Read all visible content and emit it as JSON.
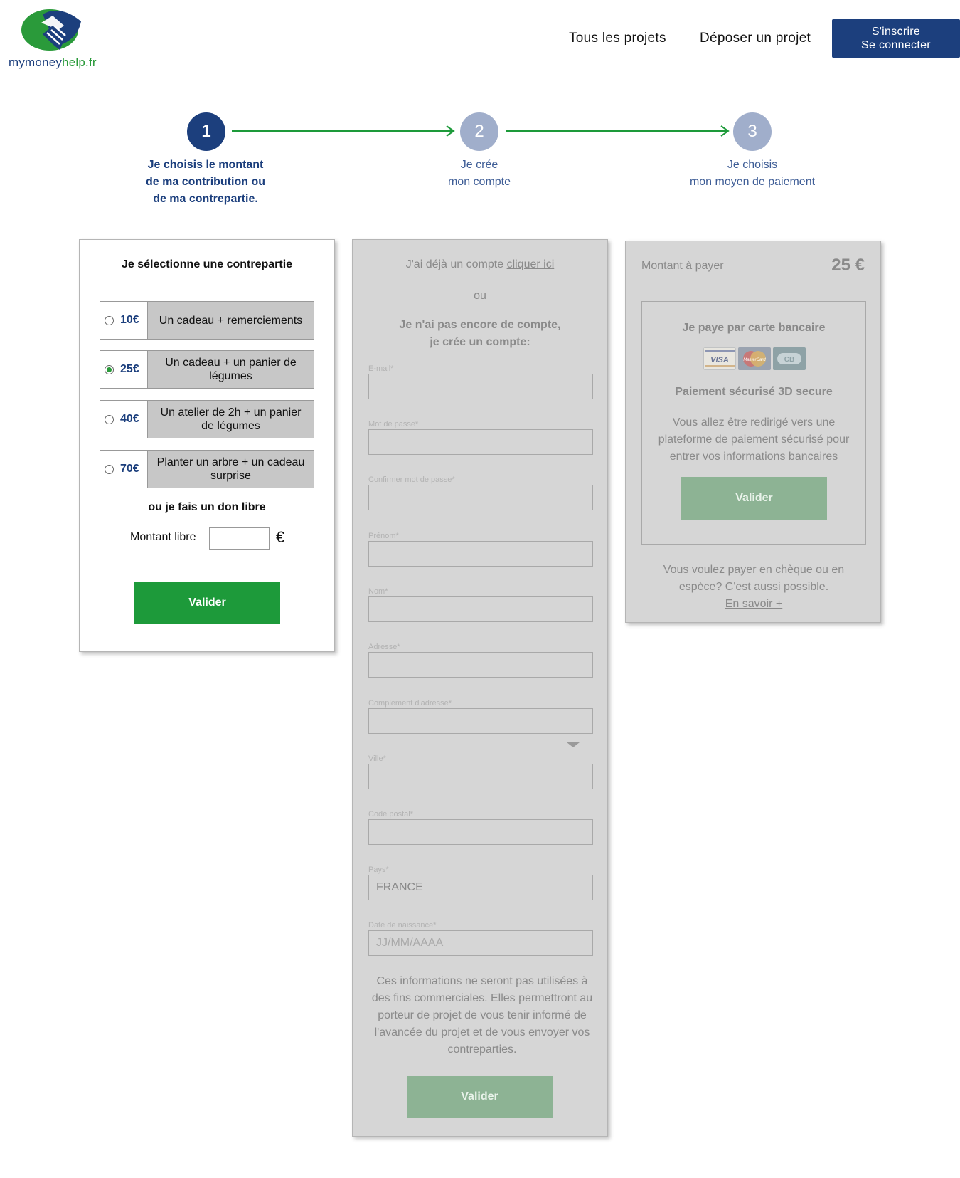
{
  "header": {
    "logo": {
      "part1": "mymoney",
      "part2": "help.fr",
      "colors": {
        "blue": "#1c3f7d",
        "green": "#2a9a3a"
      }
    },
    "nav": [
      "Tous les projets",
      "Déposer un projet"
    ],
    "auth": {
      "line1": "S'inscrire",
      "line2": "Se connecter"
    }
  },
  "stepper": {
    "steps": [
      {
        "number": "1",
        "lines": [
          "Je choisis le montant",
          "de ma contribution ou",
          "de ma contrepartie."
        ],
        "active": true
      },
      {
        "number": "2",
        "lines": [
          "Je crée",
          "mon compte"
        ],
        "active": false
      },
      {
        "number": "3",
        "lines": [
          "Je choisis",
          "mon moyen de paiement"
        ],
        "active": false
      }
    ],
    "arrow_color": "#1d9a3a"
  },
  "contrepartie": {
    "title": "Je sélectionne une contrepartie",
    "options": [
      {
        "price": "10€",
        "label": "Un cadeau + remerciements",
        "selected": false
      },
      {
        "price": "25€",
        "label": "Un cadeau + un panier de légumes",
        "selected": true
      },
      {
        "price": "40€",
        "label": "Un atelier de 2h + un panier de légumes",
        "selected": false
      },
      {
        "price": "70€",
        "label": "Planter un arbre + un cadeau surprise",
        "selected": false
      }
    ],
    "don_libre": "ou je fais un don libre",
    "montant_libre_label": "Montant libre",
    "montant_libre_value": "",
    "currency": "€",
    "submit": "Valider"
  },
  "account": {
    "already": "J'ai déjà un compte ",
    "already_link": "cliquer ici",
    "or": "ou",
    "create_line1": "Je n'ai pas encore de compte,",
    "create_line2": "je crée un compte:",
    "fields": [
      {
        "label": "E-mail*",
        "value": "",
        "placeholder": ""
      },
      {
        "label": "Mot de passe*",
        "value": "",
        "placeholder": ""
      },
      {
        "label": "Confirmer mot de passe*",
        "value": "",
        "placeholder": ""
      },
      {
        "label": "Prénom*",
        "value": "",
        "placeholder": ""
      },
      {
        "label": "Nom*",
        "value": "",
        "placeholder": ""
      },
      {
        "label": "Adresse*",
        "value": "",
        "placeholder": ""
      },
      {
        "label": "Complément d'adresse*",
        "value": "",
        "placeholder": ""
      },
      {
        "label": "Ville*",
        "value": "",
        "placeholder": ""
      },
      {
        "label": "Code postal*",
        "value": "",
        "placeholder": ""
      },
      {
        "label": "Pays*",
        "value": "FRANCE",
        "placeholder": ""
      },
      {
        "label": "Date de naissance*",
        "value": "",
        "placeholder": "JJ/MM/AAAA"
      }
    ],
    "note": "Ces informations ne seront pas utilisées à des fins commerciales. Elles permettront au porteur de projet de vous tenir informé de l'avancée du projet et de vous envoyer vos contreparties.",
    "submit": "Valider"
  },
  "payment": {
    "amount_label": "Montant à payer",
    "amount": "25 €",
    "card_title": "Je paye par carte bancaire",
    "cards": [
      "VISA",
      "MasterCard",
      "CB"
    ],
    "secure": "Paiement sécurisé 3D secure",
    "redirect": "Vous allez être redirigé vers une plateforme de paiement sécurisé pour entrer vos informations bancaires",
    "submit": "Valider",
    "alt_payment": "Vous voulez payer en chèque ou en espèce? C'est aussi possible.",
    "alt_link": "En savoir +"
  }
}
